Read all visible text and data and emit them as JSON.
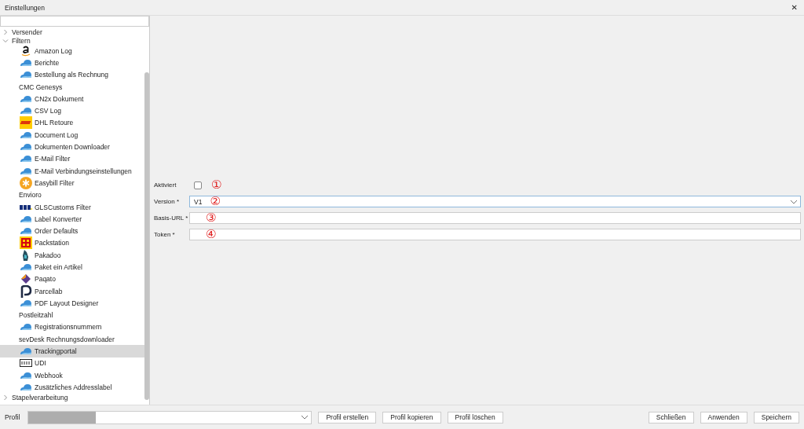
{
  "window": {
    "title": "Einstellungen",
    "close": "✕"
  },
  "sidebar": {
    "tree": [
      {
        "label": "Versender",
        "expanded": false
      },
      {
        "label": "Filtern",
        "expanded": true,
        "children": [
          {
            "label": "Amazon Log",
            "kind": "amazon",
            "selected": false
          },
          {
            "label": "Berichte",
            "kind": "cloud",
            "selected": false
          },
          {
            "label": "Bestellung als Rechnung",
            "kind": "cloud",
            "selected": false
          },
          {
            "label": "CMC Genesys",
            "kind": "none",
            "selected": false
          },
          {
            "label": "CN2x Dokument",
            "kind": "cloud",
            "selected": false
          },
          {
            "label": "CSV Log",
            "kind": "cloud",
            "selected": false
          },
          {
            "label": "DHL Retoure",
            "kind": "dhl",
            "selected": false
          },
          {
            "label": "Document Log",
            "kind": "cloud",
            "selected": false
          },
          {
            "label": "Dokumenten Downloader",
            "kind": "cloud",
            "selected": false
          },
          {
            "label": "E-Mail Filter",
            "kind": "cloud",
            "selected": false
          },
          {
            "label": "E-Mail Verbindungseinstellungen",
            "kind": "cloud",
            "selected": false
          },
          {
            "label": "Easybill Filter",
            "kind": "easybill",
            "selected": false
          },
          {
            "label": "Envioro",
            "kind": "none",
            "selected": false
          },
          {
            "label": "GLSCustoms Filter",
            "kind": "gls",
            "selected": false
          },
          {
            "label": "Label Konverter",
            "kind": "cloud",
            "selected": false
          },
          {
            "label": "Order Defaults",
            "kind": "cloud",
            "selected": false
          },
          {
            "label": "Packstation",
            "kind": "packstation",
            "selected": false
          },
          {
            "label": "Pakadoo",
            "kind": "pakadoo",
            "selected": false
          },
          {
            "label": "Paket ein Artikel",
            "kind": "cloud",
            "selected": false
          },
          {
            "label": "Paqato",
            "kind": "paqato",
            "selected": false
          },
          {
            "label": "Parcellab",
            "kind": "parcellab",
            "selected": false
          },
          {
            "label": "PDF Layout Designer",
            "kind": "cloud",
            "selected": false
          },
          {
            "label": "Postleitzahl",
            "kind": "none",
            "selected": false
          },
          {
            "label": "Registrationsnummern",
            "kind": "cloud",
            "selected": false
          },
          {
            "label": "sevDesk Rechnungsdownloader",
            "kind": "none",
            "selected": false
          },
          {
            "label": "Trackingportal",
            "kind": "cloud",
            "selected": true
          },
          {
            "label": "UDI",
            "kind": "udi",
            "selected": false
          },
          {
            "label": "Webhook",
            "kind": "cloud",
            "selected": false
          },
          {
            "label": "Zusätzliches Addresslabel",
            "kind": "cloud",
            "selected": false
          }
        ]
      },
      {
        "label": "Stapelverarbeitung",
        "expanded": false
      }
    ]
  },
  "form": {
    "fields": [
      {
        "label": "Aktiviert",
        "kind": "checkbox",
        "checked": false,
        "marker": "①"
      },
      {
        "label": "Version *",
        "kind": "dropdown",
        "value": "V1",
        "marker": "②"
      },
      {
        "label": "Basis-URL *",
        "kind": "text",
        "marker": "③"
      },
      {
        "label": "Token *",
        "kind": "text",
        "marker": "④"
      }
    ]
  },
  "footer": {
    "profile_label": "Profil",
    "profile_buttons": [
      "Profil erstellen",
      "Profil kopieren",
      "Profil löschen"
    ],
    "buttons": [
      "Schließen",
      "Anwenden",
      "Speichern"
    ]
  }
}
